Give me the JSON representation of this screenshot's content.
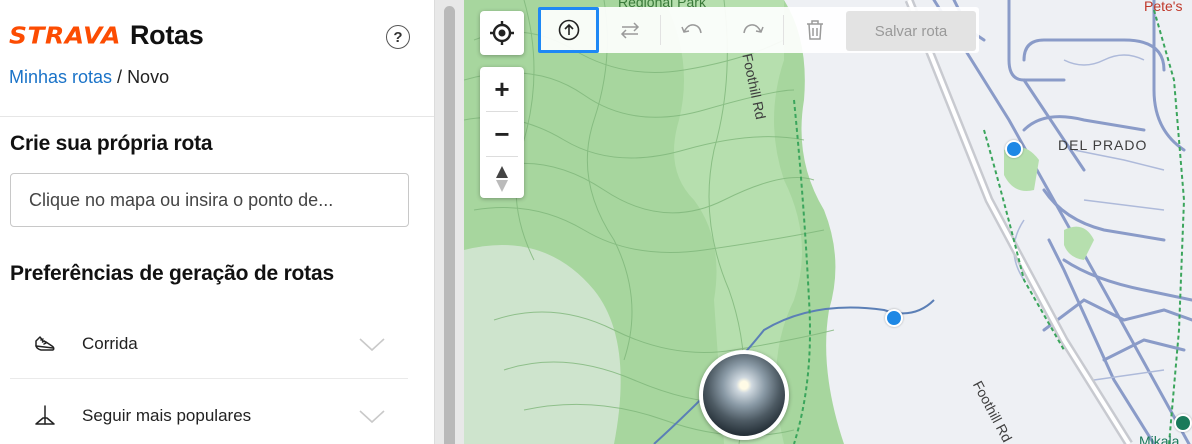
{
  "app": {
    "logo_text": "STRAVA",
    "title": "Rotas",
    "help_symbol": "?",
    "brand_color": "#fc4c02"
  },
  "breadcrumb": {
    "parent": "Minhas rotas",
    "separator": " / ",
    "current": "Novo"
  },
  "create": {
    "title": "Crie sua própria rota",
    "search_placeholder": "Clique no mapa ou insira o ponto de..."
  },
  "preferences": {
    "title": "Preferências de geração de rotas",
    "items": [
      {
        "label": "Corrida",
        "icon": "running-shoe-icon"
      },
      {
        "label": "Seguir mais populares",
        "icon": "popularity-path-icon"
      }
    ]
  },
  "map": {
    "labels": {
      "park": "Regional Park",
      "road1": "Foothill Rd",
      "road2": "Foothill Rd",
      "neighborhood": "DEL PRADO",
      "poi_top": "Pete's",
      "poi_bottom": "Mikala"
    },
    "toolbar": {
      "buttons": [
        {
          "name": "manual-mode",
          "icon": "upload-circle-icon",
          "active": true
        },
        {
          "name": "reverse",
          "icon": "swap-arrows-icon",
          "active": false
        },
        {
          "name": "undo",
          "icon": "undo-icon",
          "active": false
        },
        {
          "name": "redo",
          "icon": "redo-icon",
          "active": false
        },
        {
          "name": "delete",
          "icon": "trash-icon",
          "active": false
        }
      ],
      "save_label": "Salvar rota"
    },
    "controls": {
      "zoom_in": "+",
      "zoom_out": "−"
    },
    "colors": {
      "active_outline": "#1e88f5",
      "park_green": "#a9d9a0",
      "road_blue": "#8a9bc8"
    }
  }
}
